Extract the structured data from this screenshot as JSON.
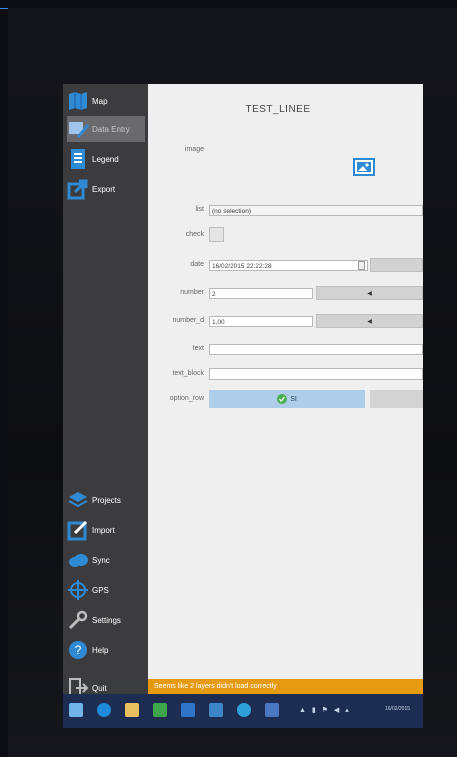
{
  "app": {
    "title": "TEST_LINEE"
  },
  "sidebar": {
    "top_items": [
      {
        "label": "Map",
        "icon": "map-icon"
      },
      {
        "label": "Data Entry",
        "icon": "data-entry-icon",
        "active": true
      },
      {
        "label": "Legend",
        "icon": "legend-icon"
      },
      {
        "label": "Export",
        "icon": "export-icon"
      }
    ],
    "bottom_items": [
      {
        "label": "Projects",
        "icon": "layers-icon"
      },
      {
        "label": "Import",
        "icon": "import-icon"
      },
      {
        "label": "Sync",
        "icon": "cloud-sync-icon"
      },
      {
        "label": "GPS",
        "icon": "crosshair-icon"
      },
      {
        "label": "Settings",
        "icon": "wrench-icon"
      },
      {
        "label": "Help",
        "icon": "help-icon"
      },
      {
        "label": "Quit",
        "icon": "exit-icon"
      }
    ]
  },
  "form": {
    "image": {
      "label": "image",
      "icon": "image-icon"
    },
    "list": {
      "label": "list",
      "value": "(no selection)"
    },
    "check": {
      "label": "check"
    },
    "date": {
      "label": "date",
      "value": "16/02/2015 22:22:28"
    },
    "number": {
      "label": "number",
      "value": "2"
    },
    "number_d": {
      "label": "number_d",
      "value": "1,00"
    },
    "text": {
      "label": "text",
      "value": ""
    },
    "text_block": {
      "label": "text_block",
      "value": ""
    },
    "option_row": {
      "label": "option_row",
      "selected_option": "SI"
    }
  },
  "status_message": "Seems like 2 layers didn't load correctly",
  "taskbar": {
    "clock_date": "16/02/2015"
  },
  "colors": {
    "sidebar_bg": "#3c3c3e",
    "accent_blue": "#2f8ad6",
    "option_selected": "#aecde8",
    "status_bar": "#e69a12",
    "taskbar": "#1d2d52"
  }
}
